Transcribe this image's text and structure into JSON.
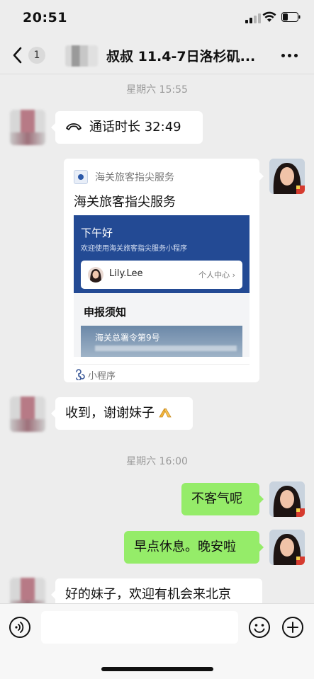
{
  "status_bar": {
    "time": "20:51",
    "battery_level": 0.35
  },
  "nav": {
    "unread_count": "1",
    "title": "叔叔 11.4-7日洛杉矶...",
    "back_icon": "chevron-left-icon",
    "more_icon": "more-horizontal-icon"
  },
  "messages": {
    "ts1": "星期六 15:55",
    "call": {
      "icon": "phone-hangup-icon",
      "text": "通话时长 32:49"
    },
    "card": {
      "source": "海关旅客指尖服务",
      "title": "海关旅客指尖服务",
      "preview": {
        "greeting": "下午好",
        "welcome": "欢迎使用海关旅客指尖服务小程序",
        "user_name": "Lily.Lee",
        "user_center": "个人中心 ›",
        "notice_title": "申报须知",
        "image_caption": "海关总署令第9号"
      },
      "footer_label": "小程序",
      "footer_icon": "mini-program-icon"
    },
    "received_1": "收到，谢谢妹子",
    "ts2": "星期六 16:00",
    "sent_1": "不客气呢",
    "sent_2": "早点休息。晚安啦",
    "received_2": "好的妹子，欢迎有机会来北京"
  },
  "input_bar": {
    "voice_icon": "voice-icon",
    "emoji_icon": "emoji-icon",
    "plus_icon": "plus-icon",
    "placeholder": ""
  },
  "colors": {
    "sent_bubble": "#95ec69",
    "received_bubble": "#ffffff",
    "background": "#ededed",
    "banner": "#234a94"
  }
}
